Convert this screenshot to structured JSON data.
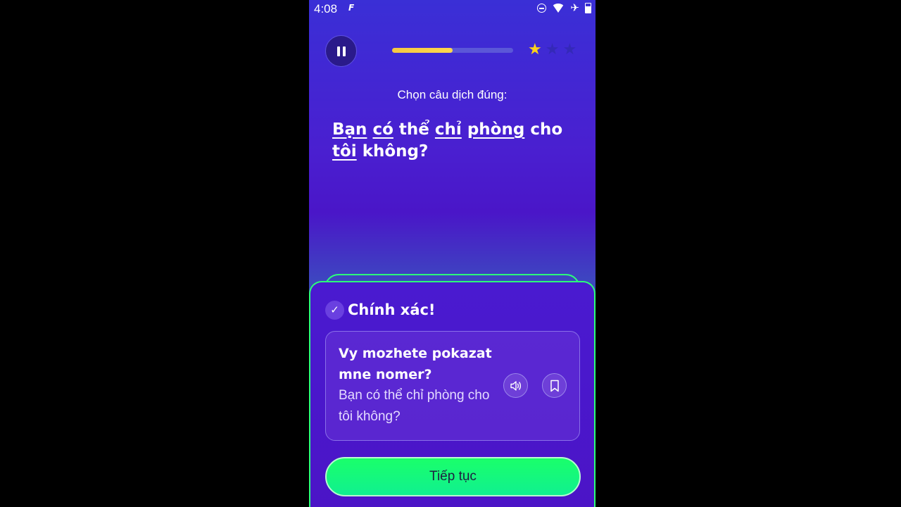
{
  "status_bar": {
    "time": "4:08",
    "app_icon": "F",
    "icons": [
      "do-not-disturb-icon",
      "wifi-icon",
      "airplane-icon",
      "battery-icon"
    ]
  },
  "lesson": {
    "progress": 0.5,
    "stars_total": 3,
    "stars_earned": 1,
    "prompt": "Chọn câu dịch đúng:",
    "question_words": [
      {
        "text": "Bạn",
        "underline": true
      },
      {
        "text": "có",
        "underline": true
      },
      {
        "text": "thể",
        "underline": false
      },
      {
        "text": "chỉ",
        "underline": true
      },
      {
        "text": "phòng",
        "underline": true
      },
      {
        "text": "cho",
        "underline": false
      },
      {
        "text": "tôi",
        "underline": true
      },
      {
        "text": "không?",
        "underline": false
      }
    ]
  },
  "result": {
    "title": "Chính xác!",
    "answer": "Vy mozhete pokazat mne nomer?",
    "translation": "Bạn có thể chỉ phòng cho tôi không?",
    "continue_label": "Tiếp tục"
  },
  "colors": {
    "accent_green": "#1aff6a",
    "star_gold": "#ffd21a",
    "progress_yellow": "#f5c842",
    "sheet_purple": "#4a1ad0"
  }
}
